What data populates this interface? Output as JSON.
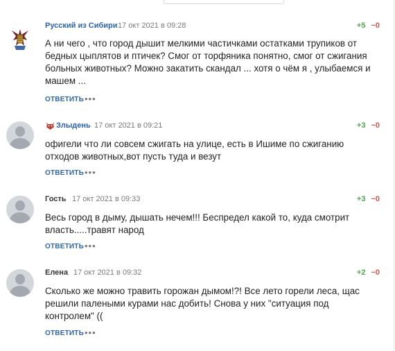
{
  "comments": [
    {
      "author": "Русский из Сибири",
      "date": "17 окт 2021 в 09:28",
      "votes_plus": "+5",
      "votes_minus": "−0",
      "text_lines": [
        "А ни чего , что город дышит мелкими частичками остатками трупиков от",
        "бедных цыплятов и птичек? Смог от торфяника понятно, смог от сжигания",
        "больных животных? Можно закатить скандал ... хотя о чём я , улыбаемся и",
        "машем ..."
      ],
      "reply": "ОТВЕТИТЬ",
      "more": "•••"
    },
    {
      "author": "Злыдень",
      "date": "17 окт 2021 в 09:21",
      "votes_plus": "+3",
      "votes_minus": "−0",
      "text_lines": [
        "офигели что ли совсем сжигать на улице, есть в Ишиме по сжиганию",
        "отходов животных,вот пусть туда и везут"
      ],
      "reply": "ОТВЕТИТЬ",
      "more": "•••"
    },
    {
      "author": "Гость",
      "date": "17 окт 2021 в 09:33",
      "votes_plus": "+3",
      "votes_minus": "−0",
      "text_lines": [
        "Весь город в дыму, дышать нечем!!! Беспредел какой то, куда смотрит",
        "власть.....травят народ"
      ],
      "reply": "ОТВЕТИТЬ",
      "more": "•••"
    },
    {
      "author": "Елена",
      "date": "17 окт 2021 в 09:32",
      "votes_plus": "+2",
      "votes_minus": "−0",
      "text_lines": [
        "Сколько же можно травить горожан дымом!?! Все лето горели леса, щас",
        "решили палеными курами нас добить! Снова у них \"ситуация под",
        "контролем\" (("
      ],
      "reply": "ОТВЕТИТЬ",
      "more": "•••"
    }
  ],
  "colors": {
    "author_link": "#2a64b2",
    "vote_plus": "#4ea64b",
    "vote_minus": "#d9534f",
    "avatar_bg": "#d3d6db"
  },
  "icons": {
    "avatar_1": "coat-of-arms-icon",
    "avatar_default": "user-silhouette-icon",
    "author_badge_2": "devil-face-icon"
  }
}
